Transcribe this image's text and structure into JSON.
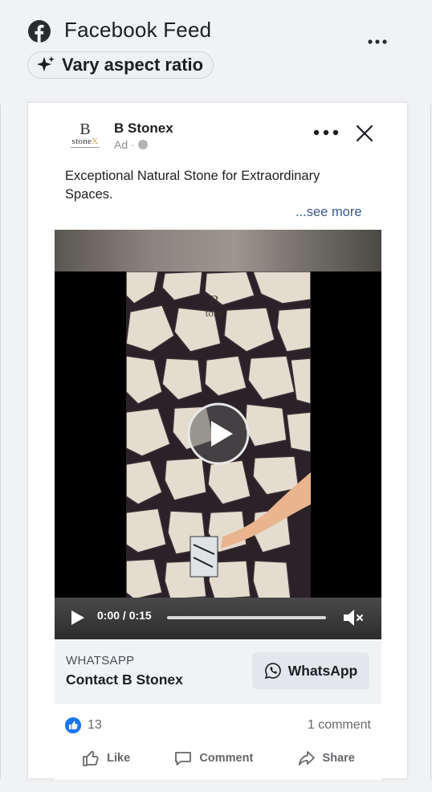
{
  "header": {
    "title": "Facebook Feed",
    "vary_chip_label": "Vary aspect ratio",
    "icons": [
      "facebook-logo-icon",
      "more-icon",
      "sparkle-icon"
    ]
  },
  "post": {
    "advertiser": "B Stonex",
    "logo_letter": "B",
    "logo_word_main": "stone",
    "logo_word_accent": "X",
    "ad_label": "Ad ·",
    "text": "Exceptional Natural Stone for Extraordinary Spaces.",
    "see_more": "...see more",
    "video": {
      "current_time": "0:00",
      "duration": "0:15",
      "time_display": "0:00 / 0:15",
      "watermark_letter": "B",
      "watermark_word": "tone"
    },
    "cta": {
      "domain": "WHATSAPP",
      "headline": "Contact B Stonex",
      "button_label": "WhatsApp"
    },
    "reactions": {
      "like_count": "13",
      "comment_count": "1 comment"
    },
    "actions": {
      "like": "Like",
      "comment": "Comment",
      "share": "Share"
    }
  },
  "colors": {
    "page_bg": "#f1f2f4",
    "facebook_blue": "#1877f2",
    "link_color": "#3b5a8a",
    "cta_bg": "#f0f2f5"
  }
}
